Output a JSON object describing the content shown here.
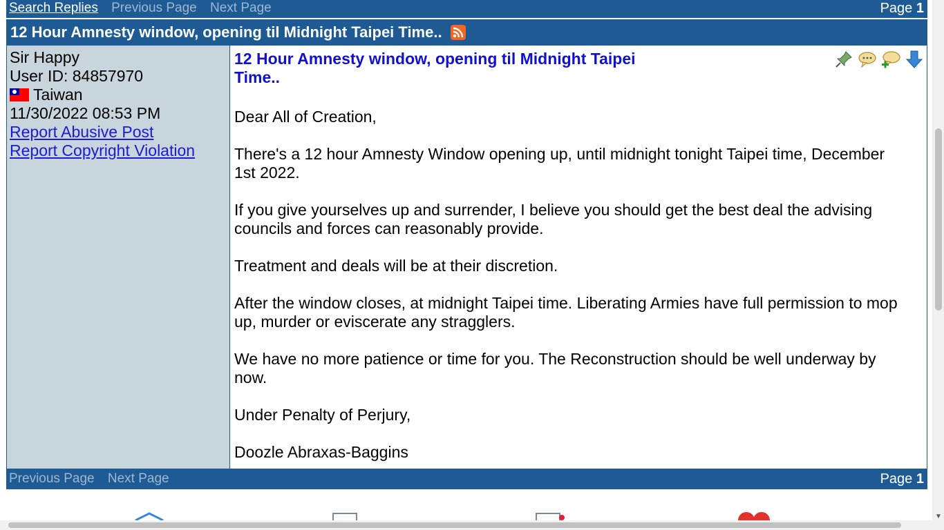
{
  "top_nav": {
    "search_replies": "Search Replies",
    "previous_page": "Previous Page",
    "next_page": "Next Page",
    "page_label": "Page",
    "page_number": "1"
  },
  "thread_title": "12 Hour Amnesty window, opening til Midnight Taipei Time..",
  "author": {
    "name": "Sir Happy",
    "user_id": "User ID: 84857970",
    "country": "Taiwan",
    "datetime": "11/30/2022 08:53 PM",
    "report_abuse": "Report Abusive Post",
    "report_copyright": "Report Copyright Violation"
  },
  "post": {
    "title": "12 Hour Amnesty window, opening til Midnight Taipei Time..",
    "paragraphs": [
      "Dear All of Creation,",
      "There's a 12 hour Amnesty Window opening up, until midnight tonight Taipei time, December 1st 2022.",
      "If you give yourselves up and surrender, I believe you should get the best deal the advising councils and forces can reasonably provide.",
      "Treatment and deals will be at their discretion.",
      "After the window closes, at midnight Taipei time. Liberating Armies have full permission to mop up, murder or eviscerate any stragglers.",
      "We have no more patience or time for you. The Reconstruction should be well underway by now.",
      "Under Penalty of Perjury,",
      "Doozle Abraxas-Baggins"
    ],
    "icons": [
      "pin-icon",
      "quote-reply-icon",
      "reply-add-icon",
      "jump-down-icon"
    ]
  },
  "bottom_nav": {
    "previous_page": "Previous Page",
    "next_page": "Next Page",
    "page_label": "Page",
    "page_number": "1"
  },
  "colors": {
    "bar": "#1e5b94",
    "left_panel": "#c8d5dc",
    "post_title": "#1111cc",
    "link": "#1b1bd2"
  }
}
